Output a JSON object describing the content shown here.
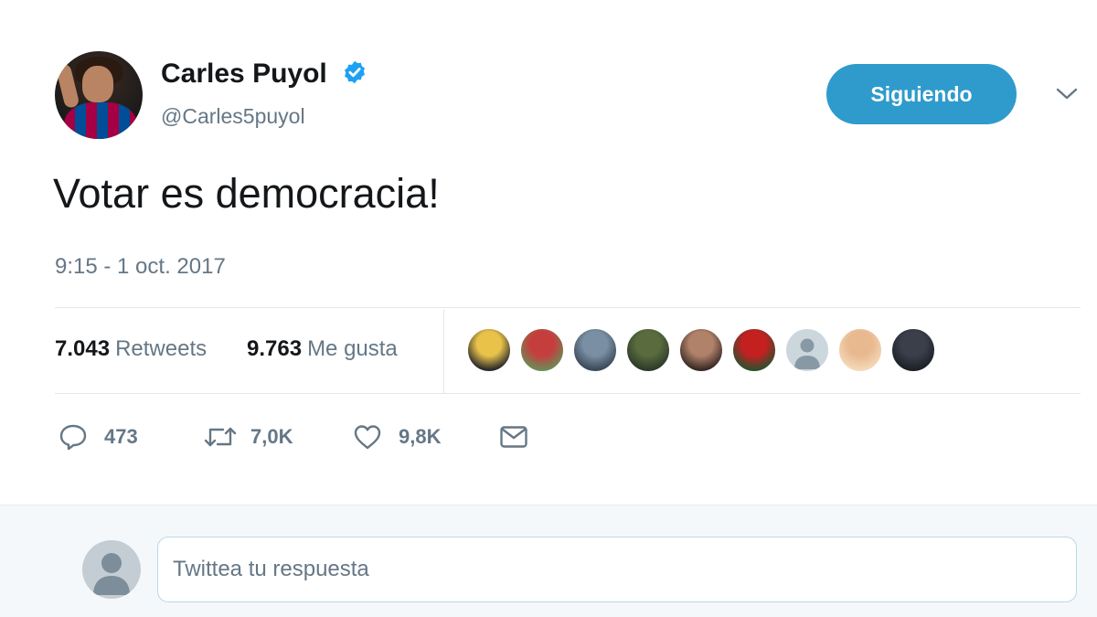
{
  "author": {
    "display_name": "Carles Puyol",
    "handle": "@Carles5puyol",
    "verified": true,
    "avatar_icon": "profile-photo"
  },
  "follow_button": {
    "label": "Siguiendo",
    "color": "#2f9bcc"
  },
  "more_menu_icon": "chevron-down-icon",
  "tweet": {
    "text": "Votar es democracia!",
    "timestamp": "9:15 - 1 oct. 2017"
  },
  "stats": {
    "retweets_count": "7.043",
    "retweets_label": "Retweets",
    "likes_count": "9.763",
    "likes_label": "Me gusta",
    "liker_avatars": [
      {
        "colors": [
          "#e9c24a",
          "#2b2b2b"
        ]
      },
      {
        "colors": [
          "#c53e3e",
          "#6d8a55"
        ]
      },
      {
        "colors": [
          "#7a8fa3",
          "#3b4a58"
        ]
      },
      {
        "colors": [
          "#5a6b3e",
          "#2d3b2a"
        ]
      },
      {
        "colors": [
          "#b0826a",
          "#3a2a25"
        ]
      },
      {
        "colors": [
          "#c42020",
          "#2f4f2f"
        ]
      },
      {
        "colors": [
          "#ccd6dd",
          "#8899a6"
        ],
        "default": true
      },
      {
        "colors": [
          "#e8b98f",
          "#f3d9b8"
        ]
      },
      {
        "colors": [
          "#3a3f4a",
          "#1c2028"
        ]
      }
    ]
  },
  "actions": {
    "reply_count": "473",
    "retweet_count": "7,0K",
    "like_count": "9,8K"
  },
  "reply": {
    "placeholder": "Twittea tu respuesta"
  },
  "colors": {
    "text_primary": "#14171a",
    "text_secondary": "#657786",
    "verified_blue": "#1da1f2",
    "border": "#e1e8ed"
  }
}
